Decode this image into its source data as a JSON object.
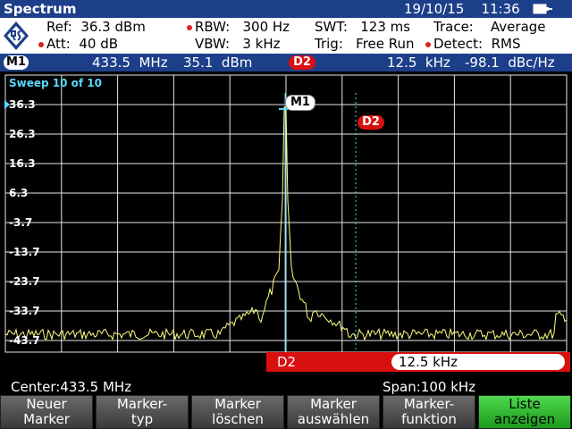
{
  "titlebar": {
    "title": "Spectrum",
    "date": "19/10/15",
    "time": "11:36"
  },
  "info": {
    "ref": "Ref:  36.3 dBm",
    "att": "Att:  40 dB",
    "rbw": "RBW:   300 Hz",
    "vbw": "VBW:   3 kHz",
    "swt": "SWT:   123 ms",
    "trig": "Trig:   Free Run",
    "trace": "Trace:    Average",
    "detect": "Detect:  RMS"
  },
  "markerbar": {
    "m1_tag": "M1",
    "m1_freq": "433.5  MHz",
    "m1_level": "35.1  dBm",
    "d2_tag": "D2",
    "d2_freq": "12.5  kHz",
    "d2_level": "-98.1  dBc/Hz"
  },
  "plot": {
    "sweep": "Sweep 10 of 10",
    "y_labels": [
      "36.3",
      "26.3",
      "16.3",
      "6.3",
      "-3.7",
      "-13.7",
      "-23.7",
      "-33.7",
      "-43.7"
    ],
    "m1_label": "M1",
    "d2_label": "D2",
    "trace_color": "#ffff80",
    "grid_color": "#e6e6e6",
    "marker_line_color": "#58d8ff"
  },
  "d2_edit": {
    "label": "D2",
    "value": "12.5 kHz"
  },
  "status": {
    "center": "Center:433.5 MHz",
    "span": "Span:100 kHz"
  },
  "softkeys": [
    {
      "line1": "Neuer",
      "line2": "Marker"
    },
    {
      "line1": "Marker-",
      "line2": "typ"
    },
    {
      "line1": "Marker",
      "line2": "löschen"
    },
    {
      "line1": "Marker",
      "line2": "auswählen"
    },
    {
      "line1": "Marker-",
      "line2": "funktion"
    },
    {
      "line1": "Liste",
      "line2": "anzeigen"
    }
  ],
  "colors": {
    "bar_blue": "#1d3f8a",
    "marker_red": "#d81010",
    "softkey_active": "#2fbf2f"
  }
}
